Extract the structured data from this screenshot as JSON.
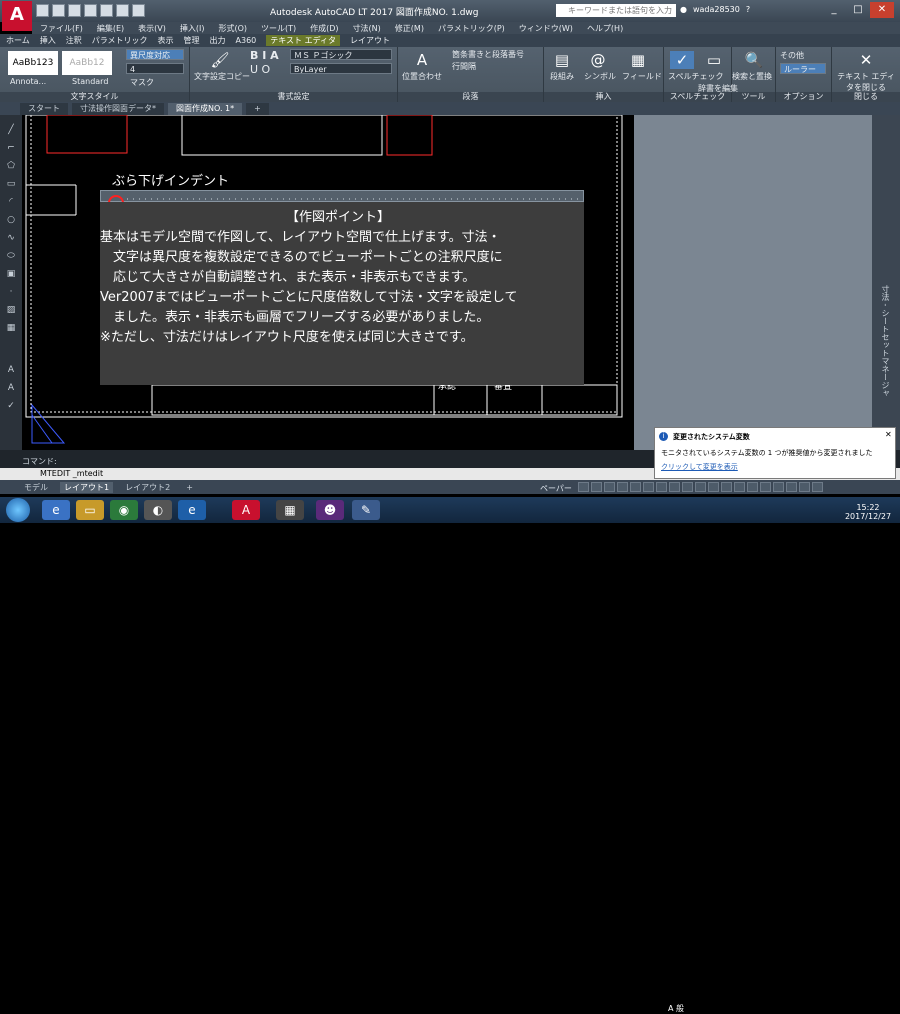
{
  "titlebar": {
    "title": "Autodesk AutoCAD LT 2017    図面作成NO. 1.dwg",
    "search_placeholder": "キーワードまたは語句を入力",
    "user": "wada28530",
    "app_logo": "A"
  },
  "menubar": [
    "ファイル(F)",
    "編集(E)",
    "表示(V)",
    "挿入(I)",
    "形式(O)",
    "ツール(T)",
    "作成(D)",
    "寸法(N)",
    "修正(M)",
    "パラメトリック(P)",
    "ウィンドウ(W)",
    "ヘルプ(H)"
  ],
  "ribbon_tabs": [
    "ホーム",
    "挿入",
    "注釈",
    "パラメトリック",
    "表示",
    "管理",
    "出力",
    "A360",
    "テキスト エディタ",
    "レイアウト"
  ],
  "ribbon": {
    "style_panel_title": "文字スタイル",
    "style1": "AaBb123",
    "style2": "AaBb12",
    "style1_label": "Annota...",
    "style2_label": "Standard",
    "annotative": "異尺度対応",
    "height_value": "4",
    "mask": "マスク",
    "match": "文字設定コピー",
    "format_panel_title": "書式設定",
    "font_value": "ＭＳ Ｐゴシック",
    "color_value": "ByLayer",
    "para_panel_title": "段落",
    "justify": "位置合わせ",
    "bullets": "箇条書きと段落番号",
    "line_spacing": "行間隔",
    "insert_panel_title": "挿入",
    "columns": "段組み",
    "symbol": "シンボル",
    "field": "フィールド",
    "spell_panel_title": "スペルチェック",
    "spellcheck": "スペルチェック",
    "dictionary": "辞書を編集",
    "tools_panel_title": "ツール",
    "find": "検索と置換",
    "options_panel_title": "オプション",
    "more": "その他",
    "ruler": "ルーラー",
    "close_panel_title": "閉じる",
    "close_editor": "テキスト エディタを閉じる"
  },
  "doc_tabs": [
    "スタート",
    "寸法操作図面データ*",
    "図面作成NO. 1*"
  ],
  "editor": {
    "hang_label": "ぶら下げインデント",
    "lines": [
      "【作図ポイント】",
      "基本はモデル空間で作図して、レイアウト空間で仕上げます。寸法・",
      "　文字は異尺度を複数設定できるのでビューポートごとの注釈尺度に",
      "　応じて大きさが自動調整され、また表示・非表示もできます。",
      "Ver2007まではビューポートごとに尺度倍数して寸法・文字を設定して",
      "　ました。表示・非表示も画層でフリーズする必要がありました。",
      "※ただし、寸法だけはレイアウト尺度を使えば同じ大きさです。"
    ],
    "table_text1": "承認",
    "table_text2": "審査"
  },
  "command": {
    "label": "コマンド:",
    "current": "MTEDIT _mtedit"
  },
  "layout_tabs": [
    "モデル",
    "レイアウト1",
    "レイアウト2"
  ],
  "status": {
    "paper": "ペーパー"
  },
  "balloon": {
    "title": "変更されたシステム変数",
    "body": "モニタされているシステム変数の 1 つが推奨値から変更されました",
    "link": "クリックして変更を表示"
  },
  "taskbar": {
    "ime": "A 般",
    "time": "15:22",
    "date": "2017/12/27"
  },
  "palette_label": "寸法 - シートセットマネージャ"
}
